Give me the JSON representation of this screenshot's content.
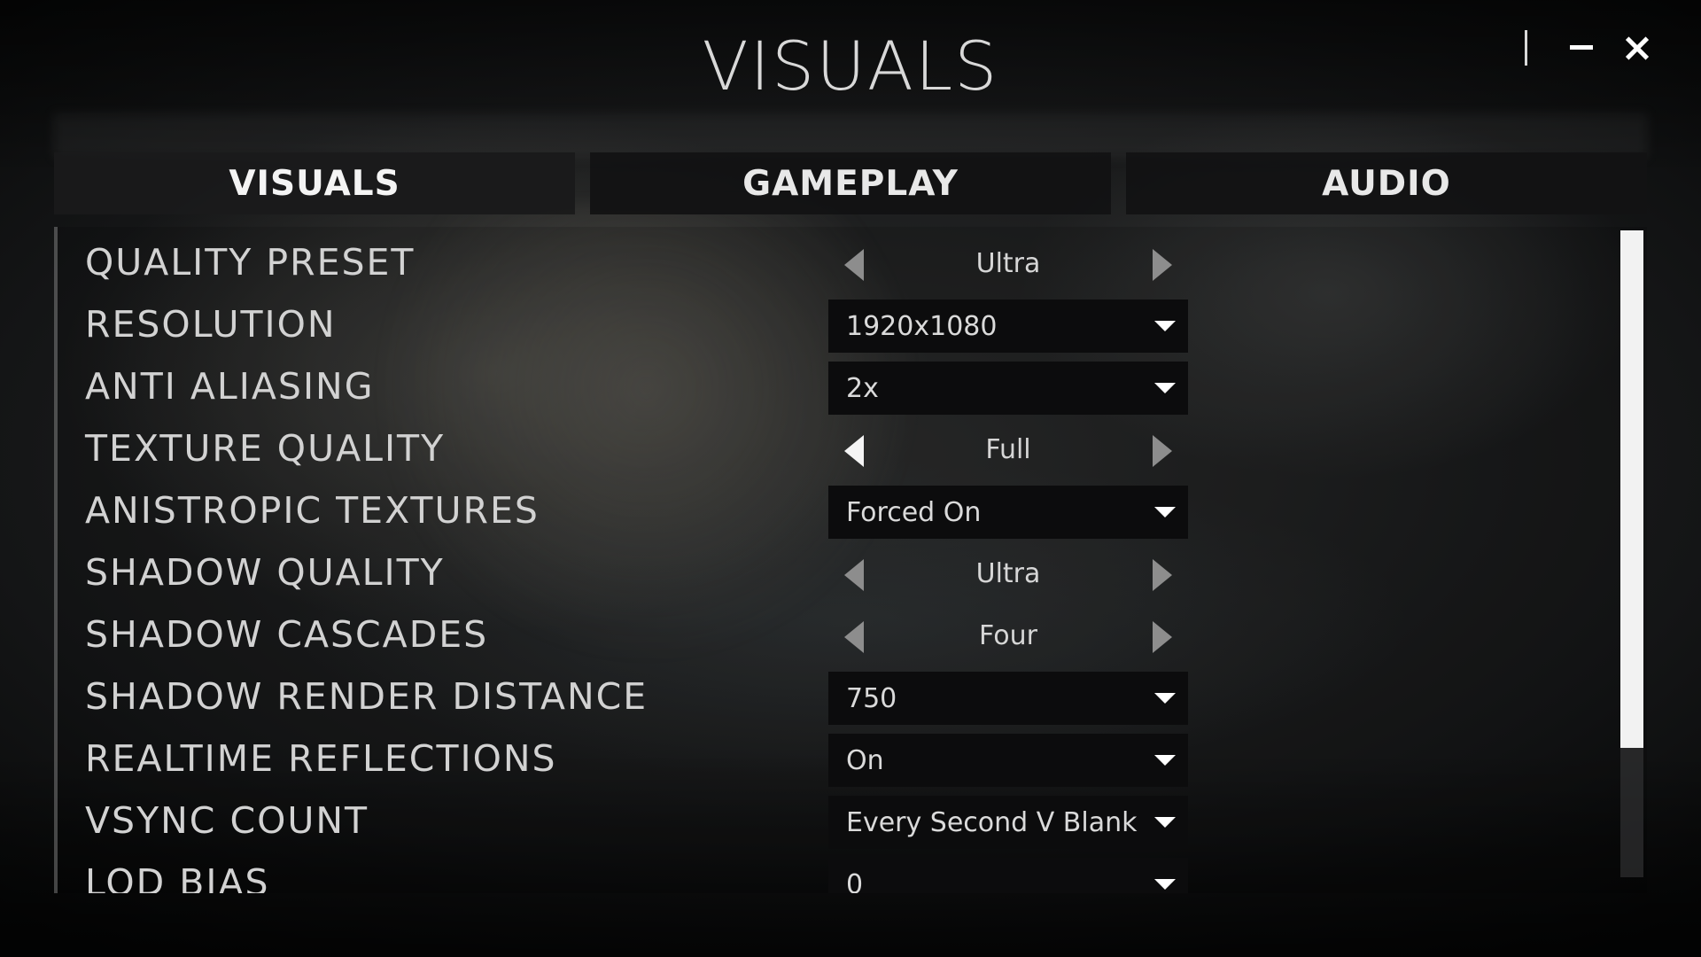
{
  "header": {
    "title": "VISUALS",
    "minimize_icon": "minimize-icon",
    "close_icon": "close-icon"
  },
  "tabs": [
    {
      "label": "VISUALS",
      "active": true
    },
    {
      "label": "GAMEPLAY",
      "active": false
    },
    {
      "label": "AUDIO",
      "active": false
    }
  ],
  "settings": [
    {
      "label": "QUALITY PRESET",
      "control": "stepper",
      "value": "Ultra"
    },
    {
      "label": "RESOLUTION",
      "control": "dropdown",
      "value": "1920x1080"
    },
    {
      "label": "ANTI ALIASING",
      "control": "dropdown",
      "value": "2x"
    },
    {
      "label": "TEXTURE QUALITY",
      "control": "stepper",
      "value": "Full",
      "left_arrow_highlighted": true
    },
    {
      "label": "ANISTROPIC TEXTURES",
      "control": "dropdown",
      "value": "Forced On"
    },
    {
      "label": "SHADOW QUALITY",
      "control": "stepper",
      "value": "Ultra"
    },
    {
      "label": "SHADOW CASCADES",
      "control": "stepper",
      "value": "Four"
    },
    {
      "label": "SHADOW RENDER DISTANCE",
      "control": "dropdown",
      "value": "750"
    },
    {
      "label": "REALTIME REFLECTIONS",
      "control": "dropdown",
      "value": "On"
    },
    {
      "label": "VSYNC COUNT",
      "control": "dropdown",
      "value": "Every Second V Blank"
    },
    {
      "label": "LOD BIAS",
      "control": "dropdown",
      "value": "0"
    }
  ],
  "scrollbar": {
    "visible_fraction": 0.8,
    "position_fraction": 0.0
  },
  "icons": {
    "stepper_left": "arrow-left-icon",
    "stepper_right": "arrow-right-icon",
    "dropdown": "caret-down-icon"
  },
  "colors": {
    "text": "#d2d2d2",
    "tab_background": "#121213",
    "dropdown_background": "#0c0c0d",
    "scroll_thumb": "#f2f2f2"
  }
}
